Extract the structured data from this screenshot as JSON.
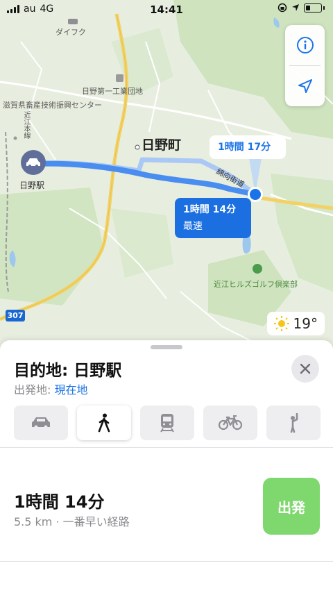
{
  "status_bar": {
    "carrier": "au",
    "network": "4G",
    "time": "14:41"
  },
  "map": {
    "labels": {
      "daifuku": "ダイフク",
      "industrial_park": "日野第一工業団地",
      "livestock_center": "滋賀県畜産技術振興センター",
      "railway": "近江本線",
      "hino_station": "日野駅",
      "town": "日野町",
      "kaido": "綿向街道",
      "golf": "近江ヒルズゴルフ倶楽部"
    },
    "route_badge": "307",
    "alt_route": {
      "time": "1時間 17分"
    },
    "main_route": {
      "time": "1時間 14分",
      "tag": "最速"
    },
    "weather": {
      "temp": "19°",
      "icon": "sun-icon"
    },
    "route_color": "#4a8df0",
    "alt_route_color": "#a9c8f5"
  },
  "sheet": {
    "title": "目的地: 日野駅",
    "from_label": "出発地: ",
    "from_value": "現在地",
    "modes": [
      "car",
      "walk",
      "transit",
      "cycle",
      "ride"
    ],
    "active_mode": "walk",
    "route": {
      "time": "1時間 14分",
      "detail": "5.5 km · 一番早い経路",
      "go_label": "出発"
    },
    "go_color": "#7fd86d"
  }
}
